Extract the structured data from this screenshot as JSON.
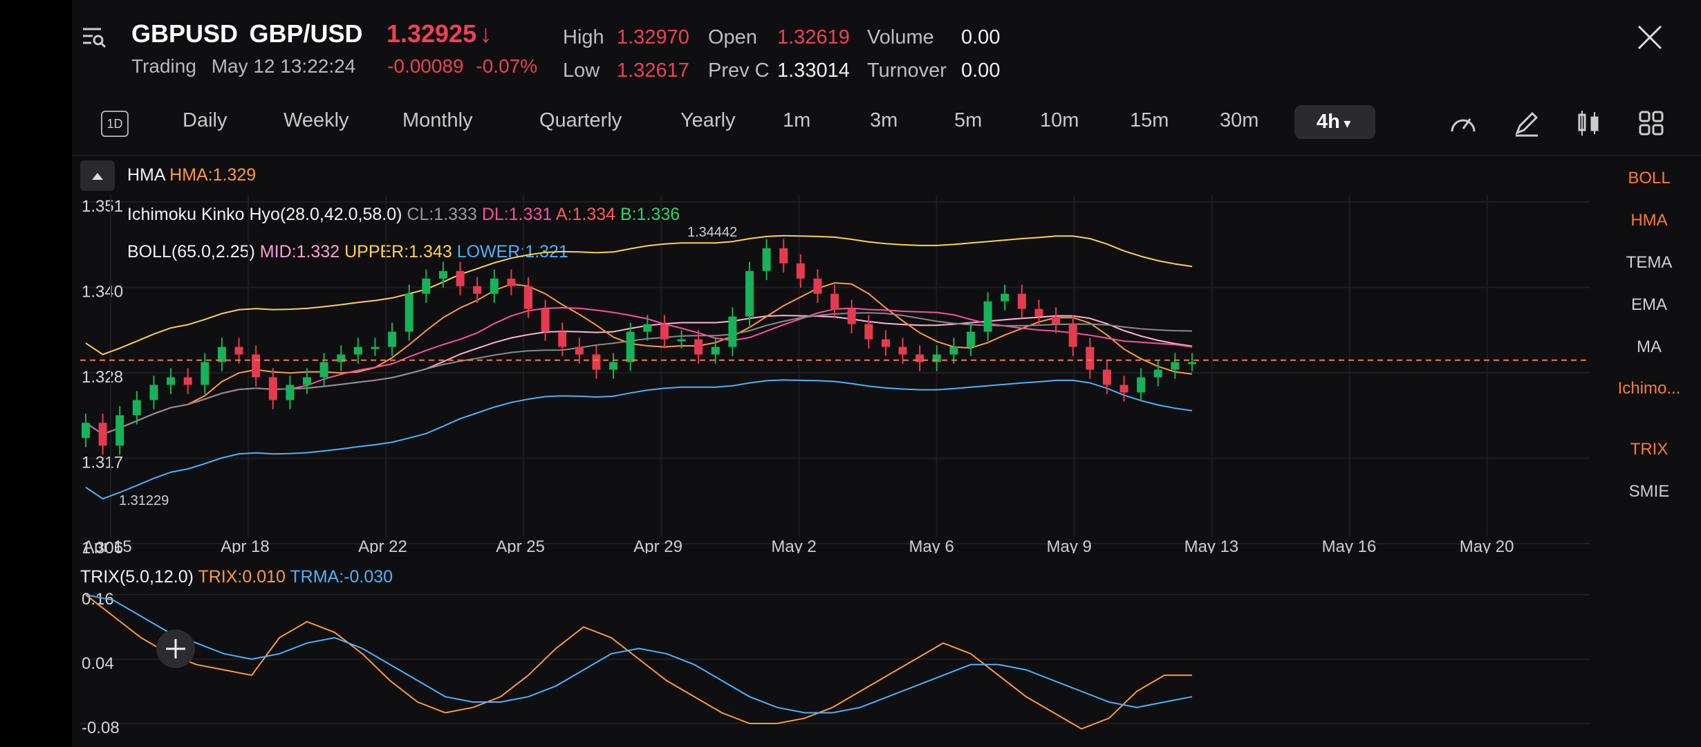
{
  "header": {
    "symbol": "GBPUSD",
    "pair": "GBP/USD",
    "price": "1.32925",
    "status": "Trading",
    "datetime": "May 12 13:22:24",
    "change": "-0.00089",
    "change_pct": "-0.07%",
    "stats": {
      "high_label": "High",
      "high": "1.32970",
      "open_label": "Open",
      "open": "1.32619",
      "volume_label": "Volume",
      "volume": "0.00",
      "low_label": "Low",
      "low": "1.32617",
      "prevc_label": "Prev C",
      "prevc": "1.33014",
      "turnover_label": "Turnover",
      "turnover": "0.00"
    }
  },
  "toolbar": {
    "chart_type_label": "1D",
    "tabs": [
      "Daily",
      "Weekly",
      "Monthly",
      "Quarterly",
      "Yearly",
      "1m",
      "3m",
      "5m",
      "10m",
      "15m",
      "30m",
      "4h"
    ],
    "active_tab": "4h"
  },
  "indicators": {
    "hma_name": "HMA",
    "hma_value": "HMA:1.329",
    "ichi_name": "Ichimoku Kinko Hyo(28.0,42.0,58.0)",
    "ichi_cl": "CL:1.333",
    "ichi_dl": "DL:1.331",
    "ichi_a": "A:1.334",
    "ichi_b": "B:1.336",
    "boll_name": "BOLL(65.0,2.25)",
    "boll_mid": "MID:1.332",
    "boll_upper": "UPPER:1.343",
    "boll_lower": "LOWER:1.321",
    "trix_name": "TRIX(5.0,12.0)",
    "trix_value": "TRIX:0.010",
    "trma_value": "TRMA:-0.030"
  },
  "right_list": [
    "BOLL",
    "HMA",
    "TEMA",
    "EMA",
    "MA",
    "Ichimo...",
    "TRIX",
    "SMIE"
  ],
  "right_list_active": [
    "BOLL",
    "HMA",
    "Ichimo...",
    "TRIX"
  ],
  "chart_data": [
    {
      "type": "candlestick",
      "y_ticks": [
        "1.351",
        "1.340",
        "1.328",
        "1.317",
        "1.306"
      ],
      "ylim": [
        1.306,
        1.351
      ],
      "x_ticks": [
        "Apr 15",
        "Apr 18",
        "Apr 22",
        "Apr 25",
        "Apr 29",
        "May 2",
        "May 6",
        "May 9",
        "May 13",
        "May 16",
        "May 20"
      ],
      "annotations": [
        "1.34442",
        "1.31229"
      ],
      "last_price": 1.32925,
      "candles_close": [
        1.321,
        1.318,
        1.322,
        1.324,
        1.326,
        1.327,
        1.326,
        1.329,
        1.331,
        1.33,
        1.327,
        1.324,
        1.326,
        1.327,
        1.329,
        1.33,
        1.331,
        1.331,
        1.333,
        1.338,
        1.34,
        1.341,
        1.339,
        1.338,
        1.34,
        1.339,
        1.336,
        1.333,
        1.331,
        1.33,
        1.328,
        1.329,
        1.333,
        1.334,
        1.332,
        1.332,
        1.33,
        1.331,
        1.335,
        1.341,
        1.344,
        1.342,
        1.34,
        1.338,
        1.336,
        1.334,
        1.332,
        1.331,
        1.33,
        1.329,
        1.33,
        1.331,
        1.333,
        1.337,
        1.338,
        1.336,
        1.335,
        1.334,
        1.331,
        1.328,
        1.326,
        1.325,
        1.327,
        1.328,
        1.329,
        1.329
      ]
    },
    {
      "type": "line",
      "y_ticks": [
        "0.16",
        "0.04",
        "-0.08"
      ],
      "ylim": [
        -0.08,
        0.16
      ],
      "series": [
        {
          "name": "TRIX",
          "values": [
            0.16,
            0.12,
            0.08,
            0.05,
            0.03,
            0.02,
            0.01,
            0.08,
            0.11,
            0.09,
            0.05,
            0.0,
            -0.04,
            -0.06,
            -0.05,
            -0.03,
            0.01,
            0.06,
            0.1,
            0.08,
            0.04,
            0.0,
            -0.03,
            -0.06,
            -0.08,
            -0.08,
            -0.07,
            -0.05,
            -0.02,
            0.01,
            0.04,
            0.07,
            0.05,
            0.01,
            -0.03,
            -0.06,
            -0.09,
            -0.07,
            -0.02,
            0.01,
            0.01
          ]
        },
        {
          "name": "TRMA",
          "values": [
            0.16,
            0.15,
            0.12,
            0.09,
            0.07,
            0.05,
            0.04,
            0.05,
            0.07,
            0.08,
            0.06,
            0.03,
            0.0,
            -0.03,
            -0.04,
            -0.04,
            -0.03,
            -0.01,
            0.02,
            0.05,
            0.06,
            0.05,
            0.03,
            0.0,
            -0.03,
            -0.05,
            -0.06,
            -0.06,
            -0.05,
            -0.03,
            -0.01,
            0.01,
            0.03,
            0.03,
            0.02,
            0.0,
            -0.02,
            -0.04,
            -0.05,
            -0.04,
            -0.03
          ]
        }
      ]
    }
  ]
}
